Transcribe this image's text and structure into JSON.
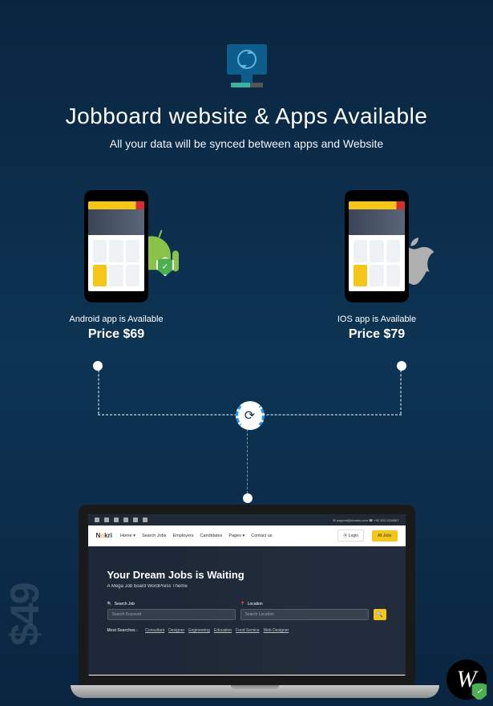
{
  "header": {
    "title": "Jobboard website & Apps Available",
    "subtitle": "All your data will be synced between apps and Website"
  },
  "apps": {
    "android": {
      "availability": "Android app is Available",
      "price": "Price $69"
    },
    "ios": {
      "availability": "IOS app is Available",
      "price": "Price $79"
    }
  },
  "website": {
    "background_price": "$49",
    "topbar_contact": "✉ support@domain.com   ☎ +92 333 1234567",
    "logo_raw": "Nokri",
    "nav": [
      "Home ▾",
      "Search Jobs",
      "Employers",
      "Candidates",
      "Pages ▾",
      "Contact us"
    ],
    "login": "⦿ Login",
    "cta": "All Jobs",
    "hero_title": "Your Dream Jobs is Waiting",
    "hero_subtitle": "A Mega Job board WordPress Theme",
    "search": {
      "job_label": "Search Job",
      "job_placeholder": "Search Keyword",
      "loc_label": "Location",
      "loc_placeholder": "Search Location"
    },
    "tags_label": "Most Searches :",
    "tags": [
      "Consultant",
      "Designer",
      "Engineering",
      "Education",
      "Food Service",
      "Web Designer"
    ]
  },
  "badge": {
    "letter": "W"
  }
}
